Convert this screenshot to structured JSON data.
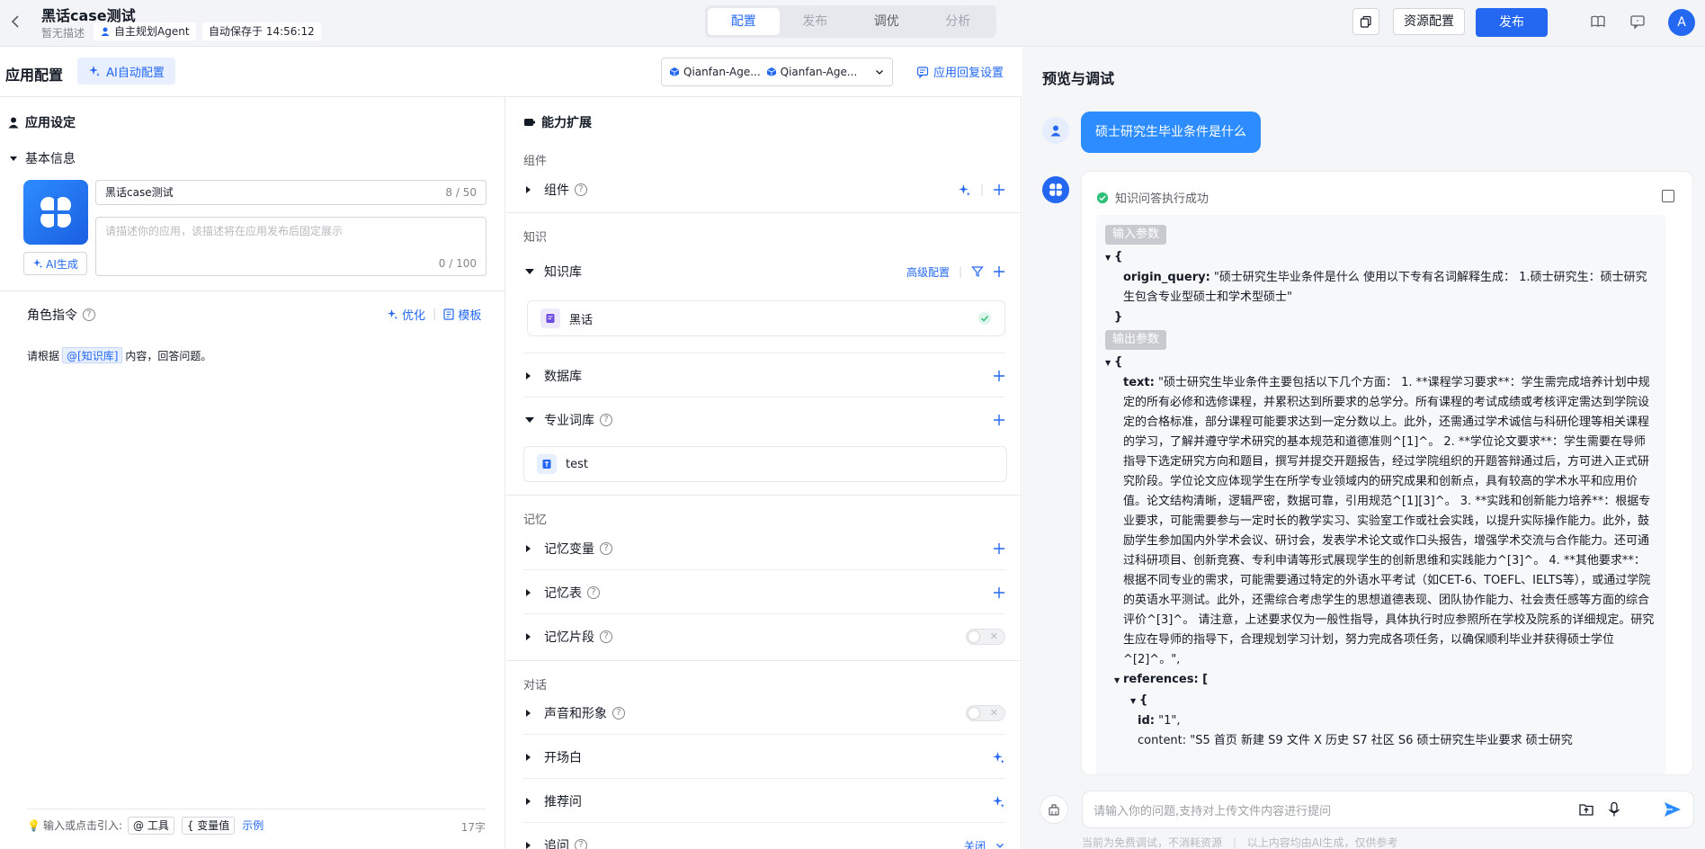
{
  "header": {
    "title": "黑话case测试",
    "description": "暂无描述",
    "agent_tag": "自主规划Agent",
    "autosave": "自动保存于 14:56:12",
    "tabs": [
      "配置",
      "发布",
      "调优",
      "分析"
    ],
    "resource_btn": "资源配置",
    "publish_btn": "发布",
    "avatar_letter": "A"
  },
  "config_header": {
    "title": "应用配置",
    "ai_config": "AI自动配置",
    "models": [
      "Qianfan-Age...",
      "Qianfan-Age..."
    ],
    "reply_settings": "应用回复设置"
  },
  "left": {
    "section_title": "应用设定",
    "basic_info": "基本信息",
    "name_value": "黑话case测试",
    "name_count": "8 / 50",
    "desc_placeholder": "请描述你的应用，该描述将在应用发布后固定展示",
    "desc_count": "0 / 100",
    "ai_gen": "AI生成",
    "role_title": "角色指令",
    "optimize": "优化",
    "template": "模板",
    "role_prefix": "请根据",
    "role_ref": "@[知识库]",
    "role_suffix": "内容，回答问题。",
    "footer_hint": "输入或点击引入:",
    "chip_tool": "@ 工具",
    "chip_var": "{ 变量值",
    "example": "示例",
    "char_count": "17字"
  },
  "mid": {
    "section_title": "能力扩展",
    "group_component": "组件",
    "row_component": "组件",
    "group_knowledge": "知识",
    "row_kb": "知识库",
    "advanced": "高级配置",
    "kb_item": "黑话",
    "row_db": "数据库",
    "row_terms": "专业词库",
    "terms_item": "test",
    "group_memory": "记忆",
    "row_mem_var": "记忆变量",
    "row_mem_table": "记忆表",
    "row_mem_clip": "记忆片段",
    "group_dialog": "对话",
    "row_voice": "声音和形象",
    "row_opening": "开场白",
    "row_suggest": "推荐问",
    "row_followup": "追问",
    "followup_state": "关闭"
  },
  "preview": {
    "title": "预览与调试",
    "user_msg": "硕士研究生毕业条件是什么",
    "exec_status": "知识问答执行成功",
    "input_tag": "输入参数",
    "output_tag": "输出参数",
    "origin_query_key": "origin_query:",
    "origin_query_val": "\"硕士研究生毕业条件是什么 使用以下专有名词解释生成： 1.硕士研究生：硕士研究生包含专业型硕士和学术型硕士\"",
    "text_key": "text:",
    "text_val": "\"硕士研究生毕业条件主要包括以下几个方面： 1. **课程学习要求**：学生需完成培养计划中规定的所有必修和选修课程，并累积达到所要求的总学分。所有课程的考试成绩或考核评定需达到学院设定的合格标准，部分课程可能要求达到一定分数以上。此外，还需通过学术诚信与科研伦理等相关课程的学习，了解并遵守学术研究的基本规范和道德准则^[1]^。 2. **学位论文要求**：学生需要在导师指导下选定研究方向和题目，撰写并提交开题报告，经过学院组织的开题答辩通过后，方可进入正式研究阶段。学位论文应体现学生在所学专业领域内的研究成果和创新点，具有较高的学术水平和应用价值。论文结构清晰，逻辑严密，数据可靠，引用规范^[1][3]^。 3. **实践和创新能力培养**：根据专业要求，可能需要参与一定时长的教学实习、实验室工作或社会实践，以提升实际操作能力。此外，鼓励学生参加国内外学术会议、研讨会，发表学术论文或作口头报告，增强学术交流与合作能力。还可通过科研项目、创新竞赛、专利申请等形式展现学生的创新思维和实践能力^[3]^。 4. **其他要求**：根据不同专业的需求，可能需要通过特定的外语水平考试（如CET-6、TOEFL、IELTS等），或通过学院的英语水平测试。此外，还需综合考虑学生的思想道德表现、团队协作能力、社会责任感等方面的综合评价^[3]^。 请注意，上述要求仅为一般性指导，具体执行时应参照所在学校及院系的详细规定。研究生应在导师的指导下，合理规划学习计划，努力完成各项任务，以确保顺利毕业并获得硕士学位^[2]^。\",",
    "references_key": "references: [",
    "id_key": "id:",
    "id_val": "\"1\",",
    "content_partial": "content: \"S5 首页 新建 S9 文件 X 历史 S7 社区 S6 硕士研究生毕业要求 硕士研究",
    "input_placeholder": "请输入你的问题,支持对上传文件内容进行提问",
    "disclaimer1": "当前为免费调试，不消耗资源",
    "disclaimer2": "以上内容均由AI生成，仅供参考"
  },
  "colors": {
    "accent": "#2468f2",
    "success": "#30bf78"
  }
}
